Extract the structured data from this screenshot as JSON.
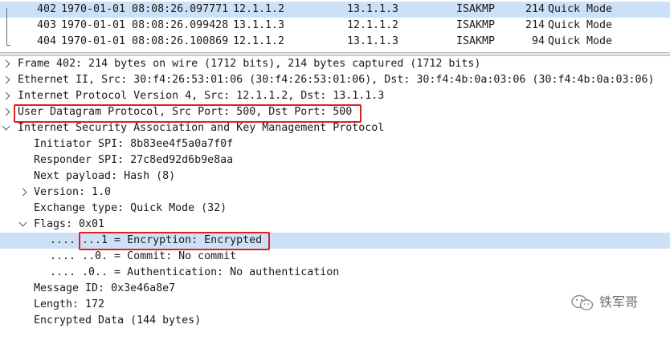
{
  "packet_list": {
    "rows": [
      {
        "no": "402",
        "time": "1970-01-01 08:08:26.097771",
        "src": "12.1.1.2",
        "dst": "13.1.1.3",
        "proto": "ISAKMP",
        "len": "214",
        "info": "Quick Mode"
      },
      {
        "no": "403",
        "time": "1970-01-01 08:08:26.099428",
        "src": "13.1.1.3",
        "dst": "12.1.1.2",
        "proto": "ISAKMP",
        "len": "214",
        "info": "Quick Mode"
      },
      {
        "no": "404",
        "time": "1970-01-01 08:08:26.100869",
        "src": "12.1.1.2",
        "dst": "13.1.1.3",
        "proto": "ISAKMP",
        "len": "94",
        "info": "Quick Mode"
      }
    ]
  },
  "details": {
    "frame": "Frame 402: 214 bytes on wire (1712 bits), 214 bytes captured (1712 bits)",
    "ethernet": "Ethernet II, Src: 30:f4:26:53:01:06 (30:f4:26:53:01:06), Dst: 30:f4:4b:0a:03:06 (30:f4:4b:0a:03:06)",
    "ip": "Internet Protocol Version 4, Src: 12.1.1.2, Dst: 13.1.1.3",
    "udp": "User Datagram Protocol, Src Port: 500, Dst Port: 500",
    "isakmp": "Internet Security Association and Key Management Protocol",
    "initiator_spi": "Initiator SPI: 8b83ee4f5a0a7f0f",
    "responder_spi": "Responder SPI: 27c8ed92d6b9e8aa",
    "next_payload": "Next payload: Hash (8)",
    "version": "Version: 1.0",
    "exchange_type": "Exchange type: Quick Mode (32)",
    "flags": "Flags: 0x01",
    "flag_encryption": ".... ...1 = Encryption: Encrypted",
    "flag_commit": ".... ..0. = Commit: No commit",
    "flag_auth": ".... .0.. = Authentication: No authentication",
    "message_id": "Message ID: 0x3e46a8e7",
    "length": "Length: 172",
    "encrypted_data": "Encrypted Data (144 bytes)"
  },
  "watermark": {
    "text": "铁军哥",
    "icon": "wechat-icon"
  },
  "colors": {
    "selection": "#cce1f7",
    "annotation": "#e02020"
  }
}
